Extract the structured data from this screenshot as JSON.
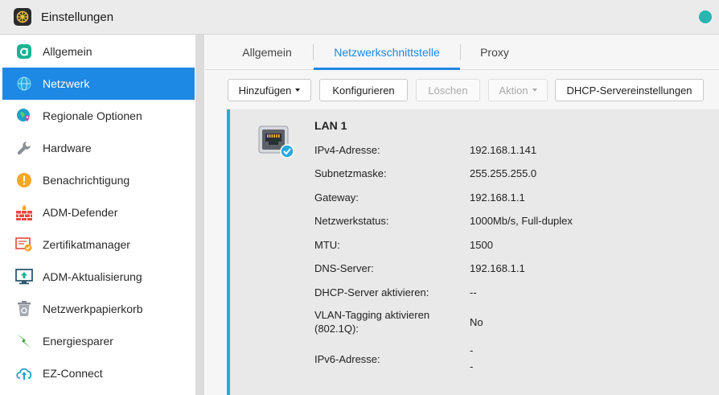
{
  "window": {
    "title": "Einstellungen"
  },
  "sidebar": {
    "items": [
      {
        "label": "Allgemein",
        "icon": "general-icon"
      },
      {
        "label": "Netzwerk",
        "icon": "globe-icon",
        "active": true
      },
      {
        "label": "Regionale Optionen",
        "icon": "region-pin-icon"
      },
      {
        "label": "Hardware",
        "icon": "wrench-icon"
      },
      {
        "label": "Benachrichtigung",
        "icon": "alert-icon"
      },
      {
        "label": "ADM-Defender",
        "icon": "firewall-icon"
      },
      {
        "label": "Zertifikatmanager",
        "icon": "certificate-icon"
      },
      {
        "label": "ADM-Aktualisierung",
        "icon": "monitor-update-icon"
      },
      {
        "label": "Netzwerkpapierkorb",
        "icon": "recycle-bin-icon"
      },
      {
        "label": "Energiesparer",
        "icon": "lightning-icon"
      },
      {
        "label": "EZ-Connect",
        "icon": "cloud-upload-icon"
      }
    ]
  },
  "tabs": [
    {
      "label": "Allgemein"
    },
    {
      "label": "Netzwerkschnittstelle",
      "active": true
    },
    {
      "label": "Proxy"
    }
  ],
  "toolbar": {
    "add": "Hinzufügen",
    "configure": "Konfigurieren",
    "delete": "Löschen",
    "action": "Aktion",
    "dhcp": "DHCP-Servereinstellungen"
  },
  "interface": {
    "name": "LAN 1",
    "rows": [
      {
        "label": "IPv4-Adresse:",
        "value": "192.168.1.141"
      },
      {
        "label": "Subnetzmaske:",
        "value": "255.255.255.0"
      },
      {
        "label": "Gateway:",
        "value": "192.168.1.1"
      },
      {
        "label": "Netzwerkstatus:",
        "value": "1000Mb/s, Full-duplex"
      },
      {
        "label": "MTU:",
        "value": "1500"
      },
      {
        "label": "DNS-Server:",
        "value": "192.168.1.1"
      },
      {
        "label": "DHCP-Server aktivieren:",
        "value": "--"
      }
    ],
    "vlan": {
      "label_line1": "VLAN-Tagging aktivieren",
      "label_line2": "(802.1Q):",
      "value": "No"
    },
    "ipv6": {
      "label": "IPv6-Adresse:",
      "value_line1": "-",
      "value_line2": "-"
    }
  },
  "colors": {
    "accent": "#1e88e5",
    "status": "#2bb5b0",
    "card_border": "#29a9e1"
  }
}
